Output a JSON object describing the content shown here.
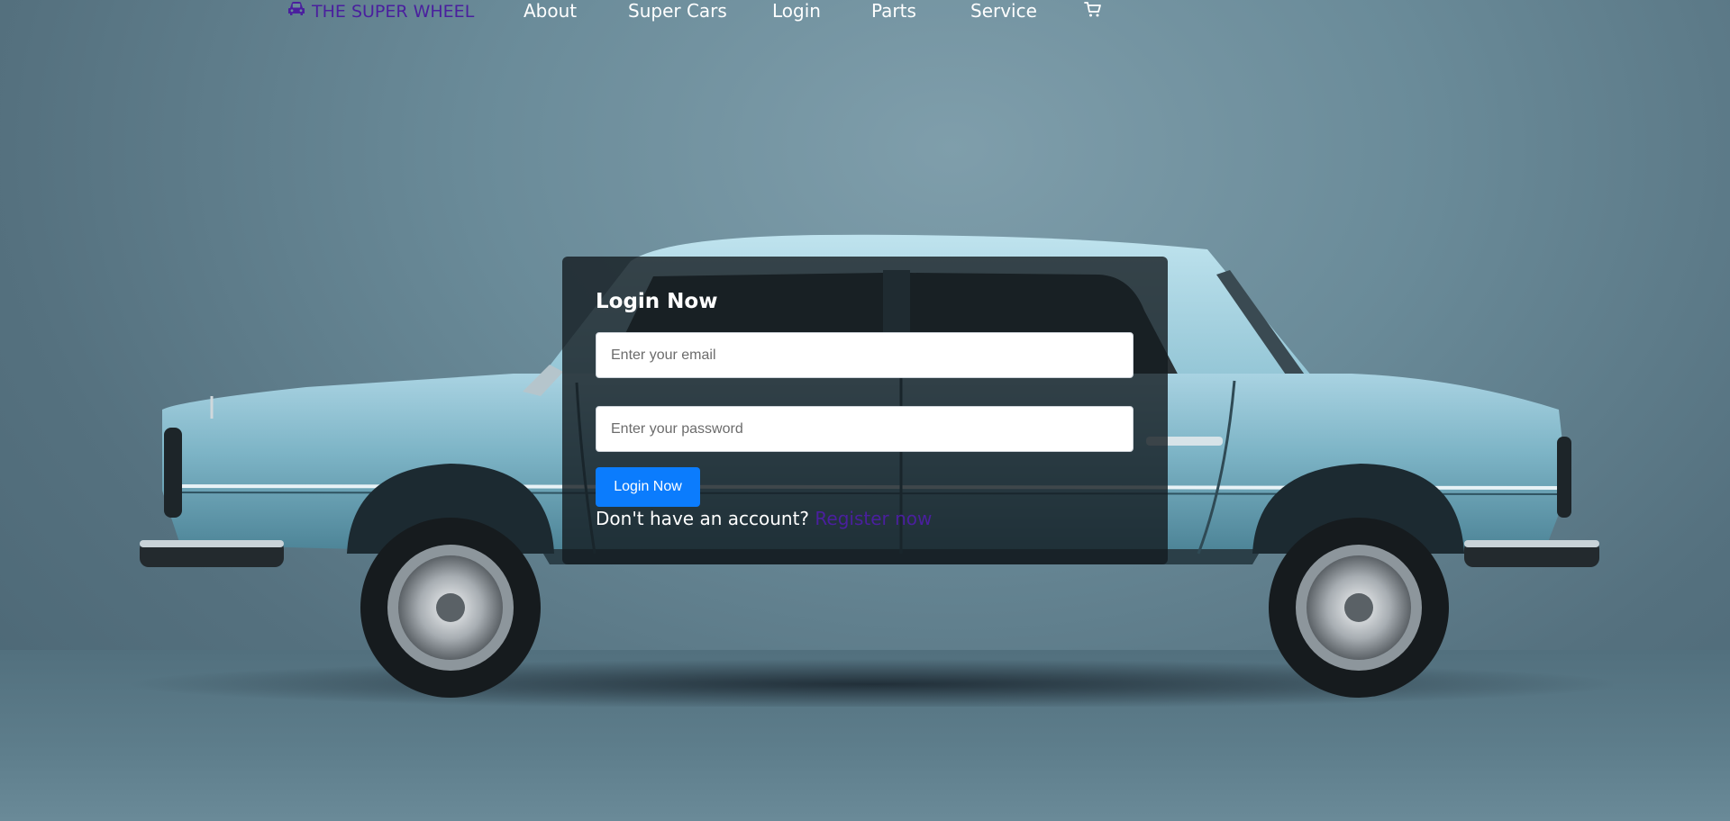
{
  "nav": {
    "brand_icon": "car-icon",
    "brand_text": "THE SUPER WHEEL",
    "links": [
      "About",
      "Super Cars",
      "Login",
      "Parts",
      "Service"
    ],
    "cart_icon": "cart-icon"
  },
  "login": {
    "title": "Login Now",
    "email_placeholder": "Enter your email",
    "email_value": "",
    "password_placeholder": "Enter your password",
    "password_value": "",
    "button_label": "Login Now",
    "register_prompt": "Don't have an account?",
    "register_link": "Register now"
  },
  "colors": {
    "brand": "#4a1f9e",
    "primary_button": "#0b7cfd",
    "overlay": "#141c20"
  }
}
